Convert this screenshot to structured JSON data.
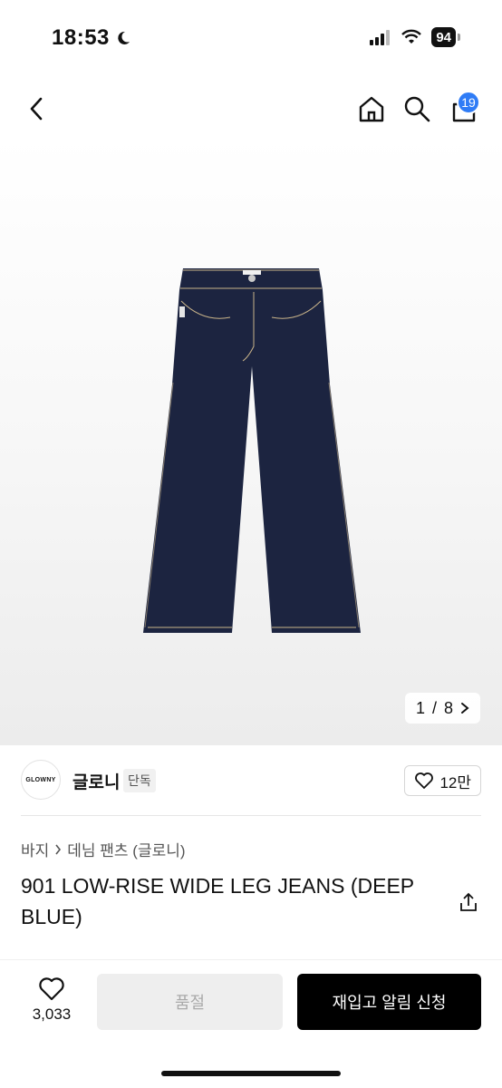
{
  "status": {
    "time": "18:53",
    "battery": "94"
  },
  "nav": {
    "cart_count": "19"
  },
  "gallery": {
    "current": "1",
    "total": "8",
    "separator": "/"
  },
  "brand": {
    "logo_text": "GLOWNY",
    "name": "글로니",
    "tag": "단독",
    "likes": "12만"
  },
  "breadcrumb": {
    "category": "바지",
    "subcategory": "데님 팬츠 (글로니)"
  },
  "product": {
    "title": "901 LOW-RISE WIDE LEG JEANS (DEEP BLUE)"
  },
  "bottom_bar": {
    "wish_count": "3,033",
    "soldout_label": "품절",
    "restock_label": "재입고 알림 신청"
  },
  "colors": {
    "accent": "#2f7cf6",
    "denim": "#1c2440",
    "stitch": "#c9b48a"
  },
  "icons": [
    "moon-icon",
    "signal-icon",
    "wifi-icon",
    "back-icon",
    "home-icon",
    "search-icon",
    "cart-icon",
    "chevron-right-icon",
    "heart-icon",
    "share-icon"
  ]
}
